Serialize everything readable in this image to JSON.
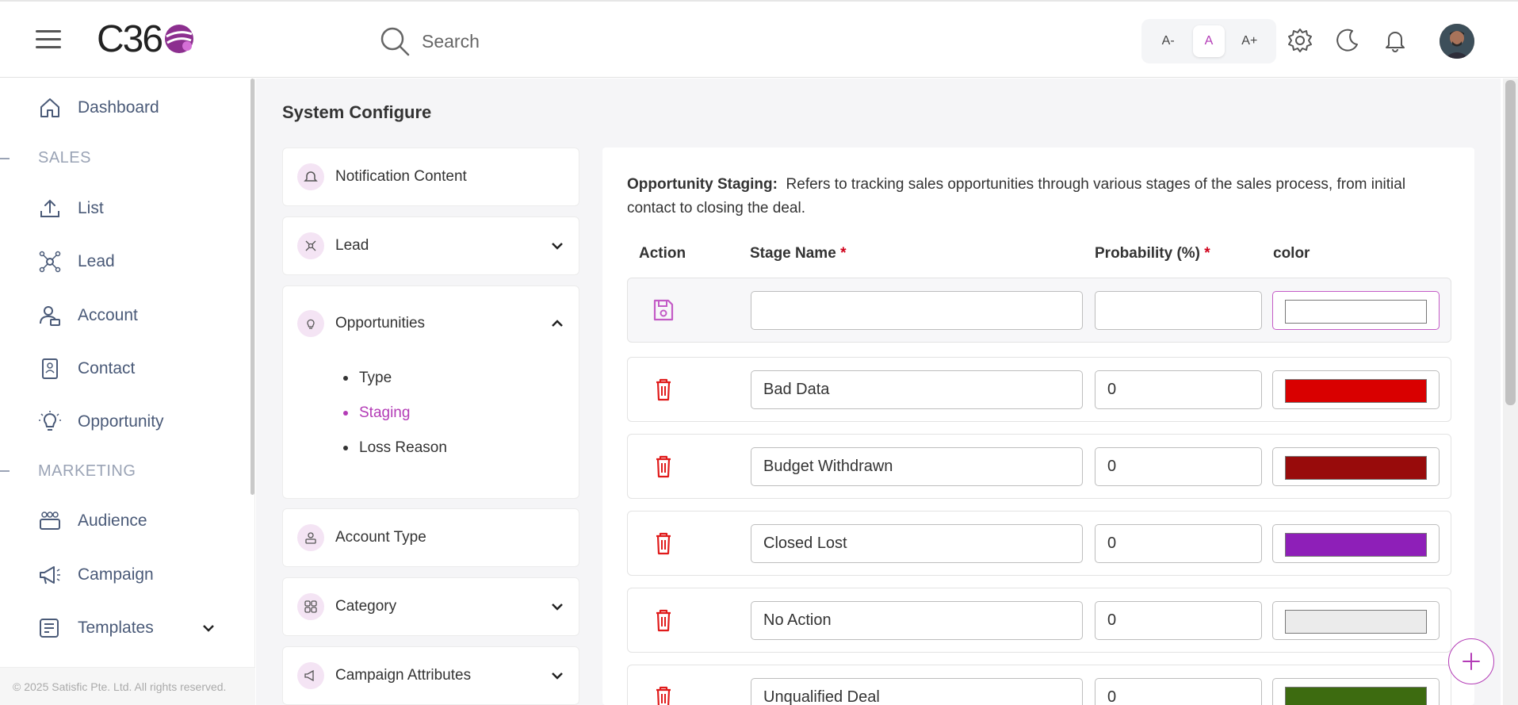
{
  "header": {
    "logo_text": "C36",
    "search_placeholder": "Search",
    "font_sizes": [
      "A-",
      "A",
      "A+"
    ],
    "accent_color": "#b33bb6"
  },
  "sidebar": {
    "items": [
      {
        "label": "Dashboard",
        "icon": "home-icon"
      },
      {
        "section": "SALES"
      },
      {
        "label": "List",
        "icon": "upload-icon"
      },
      {
        "label": "Lead",
        "icon": "network-icon"
      },
      {
        "label": "Account",
        "icon": "user-card-icon"
      },
      {
        "label": "Contact",
        "icon": "contact-card-icon"
      },
      {
        "label": "Opportunity",
        "icon": "lightbulb-icon"
      },
      {
        "section": "MARKETING"
      },
      {
        "label": "Audience",
        "icon": "group-icon"
      },
      {
        "label": "Campaign",
        "icon": "megaphone-icon"
      },
      {
        "label": "Templates",
        "icon": "template-icon"
      }
    ],
    "footer": "© 2025 Satisfic Pte. Ltd. All rights reserved."
  },
  "main": {
    "title": "System Configure",
    "config_menu": [
      {
        "label": "Notification Content"
      },
      {
        "label": "Lead"
      },
      {
        "label": "Opportunities",
        "children": [
          "Type",
          "Staging",
          "Loss Reason"
        ],
        "active_child": "Staging"
      },
      {
        "label": "Account Type"
      },
      {
        "label": "Category"
      },
      {
        "label": "Campaign Attributes"
      }
    ],
    "panel": {
      "desc_title": "Opportunity Staging:",
      "desc_text": "Refers to tracking sales opportunities through various stages of the sales process, from initial contact to closing the deal.",
      "columns": {
        "action": "Action",
        "stage": "Stage Name",
        "prob": "Probability (%)",
        "color": "color",
        "required_mark": "*"
      },
      "new_row": {
        "name": "",
        "probability": "",
        "color": "#ffffff"
      },
      "stages": [
        {
          "name": "Bad Data",
          "probability": "0",
          "color": "#d90000"
        },
        {
          "name": "Budget Withdrawn",
          "probability": "0",
          "color": "#980b0b"
        },
        {
          "name": "Closed Lost",
          "probability": "0",
          "color": "#8e1fb8"
        },
        {
          "name": "No Action",
          "probability": "0",
          "color": "#ebebeb"
        },
        {
          "name": "Unqualified Deal",
          "probability": "0",
          "color": "#3d6b10"
        }
      ]
    }
  }
}
